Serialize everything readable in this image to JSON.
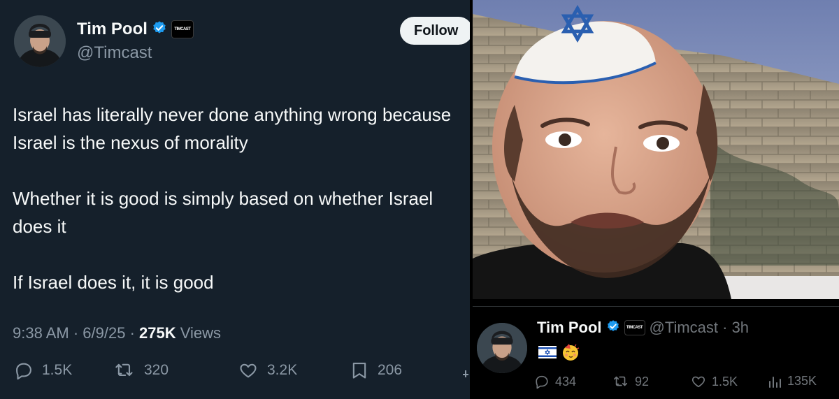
{
  "left_tweet": {
    "display_name": "Tim Pool",
    "handle": "@Timcast",
    "affiliate_badge": "TIMCAST",
    "follow_label": "Follow",
    "text_paragraphs": [
      "Israel has literally never done anything wrong because Israel is the nexus of morality",
      "Whether it is good is simply based on whether Israel does it",
      "If Israel does it, it is good"
    ],
    "time": "9:38 AM",
    "date": "6/9/25",
    "views_count": "275K",
    "views_label": "Views",
    "sep": "·",
    "actions": {
      "replies": "1.5K",
      "reposts": "320",
      "likes": "3.2K",
      "bookmarks": "206"
    }
  },
  "right_post": {
    "display_name": "Tim Pool",
    "affiliate_badge": "TIMCAST",
    "handle_time": "@Timcast · 3h",
    "emoji_flag": "🇮🇱",
    "emoji_face": "🥳",
    "actions": {
      "replies": "434",
      "reposts": "92",
      "likes": "1.5K",
      "views": "135K"
    }
  },
  "colors": {
    "left_bg": "#15202b",
    "right_bg": "#000000",
    "verified_blue": "#1d9bf0",
    "muted_text": "#8b98a5",
    "follow_bg": "#eff3f4"
  },
  "icons": [
    "verified-icon",
    "reply-icon",
    "repost-icon",
    "like-icon",
    "bookmark-icon",
    "views-icon",
    "share-icon"
  ]
}
